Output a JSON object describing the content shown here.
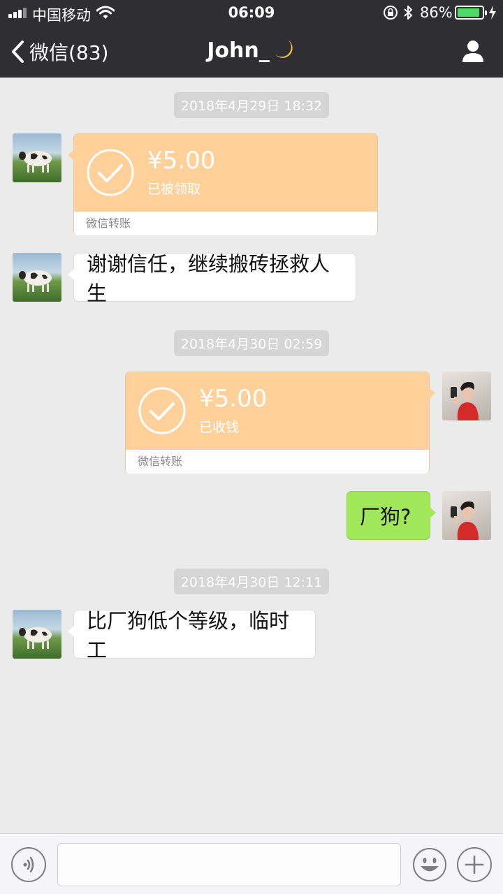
{
  "status_bar": {
    "carrier": "中国移动",
    "time": "06:09",
    "battery_percent": "86%",
    "battery_level": 0.86
  },
  "nav": {
    "back_label": "微信(83)",
    "title": "John_",
    "title_emoji_icon": "crescent-moon-icon",
    "profile_icon": "person-icon"
  },
  "chat": {
    "ts1": "2018年4月29日 18:32",
    "msg1": {
      "sender": "contact",
      "type": "transfer",
      "amount": "¥5.00",
      "status": "已被领取",
      "footer": "微信转账"
    },
    "msg2": {
      "sender": "contact",
      "type": "text",
      "text": "谢谢信任，继续搬砖拯救人生"
    },
    "ts2": "2018年4月30日 02:59",
    "msg3": {
      "sender": "me",
      "type": "transfer",
      "amount": "¥5.00",
      "status": "已收钱",
      "footer": "微信转账"
    },
    "msg4": {
      "sender": "me",
      "type": "text",
      "text": "厂狗?"
    },
    "ts3": "2018年4月30日 12:11",
    "msg5": {
      "sender": "contact",
      "type": "text",
      "text": "比厂狗低个等级，临时工"
    }
  },
  "input_bar": {
    "voice_icon": "voice-icon",
    "input_value": "",
    "emoji_icon": "emoji-icon",
    "plus_icon": "plus-icon"
  },
  "colors": {
    "nav_bg": "#2f2f33",
    "chat_bg": "#ebebeb",
    "transfer_bg": "#fed19b",
    "my_bubble": "#a0e75a",
    "battery_green": "#4cd964"
  }
}
